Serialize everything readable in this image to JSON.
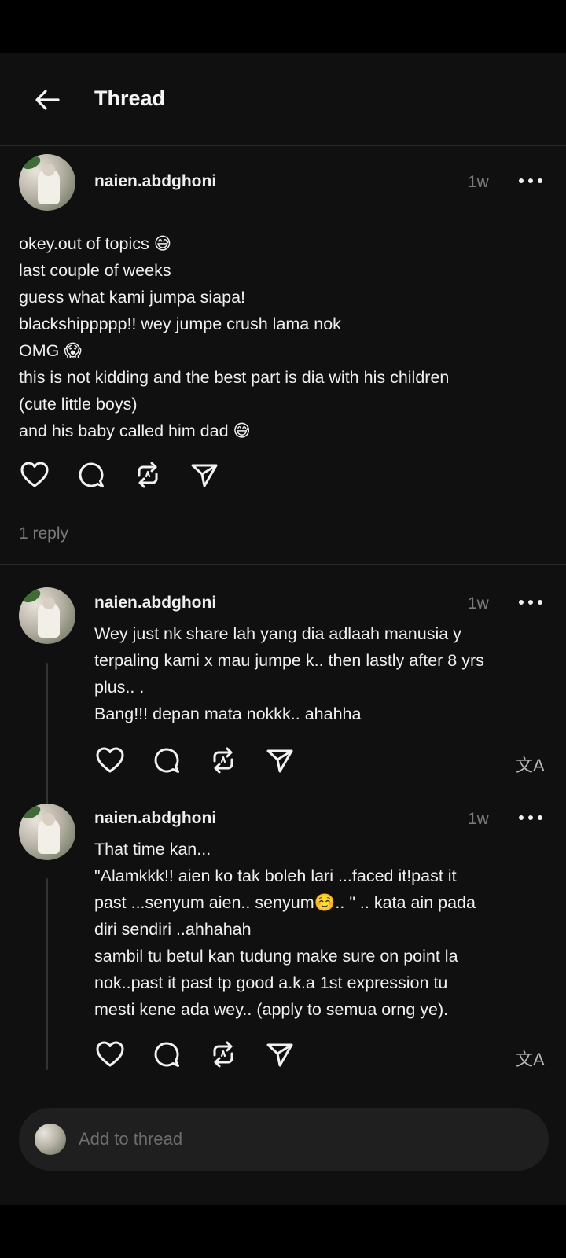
{
  "header": {
    "title": "Thread"
  },
  "post": {
    "username": "naien.abdghoni",
    "time": "1w",
    "text": "okey.out of topics 😅\nlast couple of weeks\nguess what kami jumpa siapa!\nblackshippppp!! wey jumpe crush lama nok\nOMG 😱\nthis is not kidding and the best part is dia with his children\n(cute little boys)\nand his baby called him dad 😅",
    "reply_count": "1 reply"
  },
  "replies": [
    {
      "username": "naien.abdghoni",
      "time": "1w",
      "text": "Wey just nk share lah yang dia adlaah manusia y\nterpaling kami x mau jumpe k.. then lastly after 8 yrs\nplus.. .\nBang!!! depan mata nokkk.. ahahha",
      "translate": "文A"
    },
    {
      "username": "naien.abdghoni",
      "time": "1w",
      "text": "That time kan...\n\"Alamkkk!! aien ko tak boleh lari ...faced it!past it\npast ...senyum aien.. senyum☺️.. \" .. kata ain pada\ndiri sendiri ..ahhahah\nsambil tu betul kan tudung make sure on point la\nnok..past it past tp good a.k.a 1st expression tu\nmesti kene ada wey.. (apply to semua orng ye).",
      "translate": "文A"
    }
  ],
  "composer": {
    "placeholder": "Add to thread"
  },
  "icons": {
    "back": "arrow-left-icon",
    "like": "heart-icon",
    "comment": "comment-bubble-icon",
    "repost": "repost-icon",
    "share": "send-icon",
    "more": "more-horizontal-icon",
    "translate": "translate-icon"
  },
  "colors": {
    "background": "#101010",
    "text": "#f0f0f0",
    "muted": "#7a7a7a",
    "divider": "#2a2a2a"
  }
}
